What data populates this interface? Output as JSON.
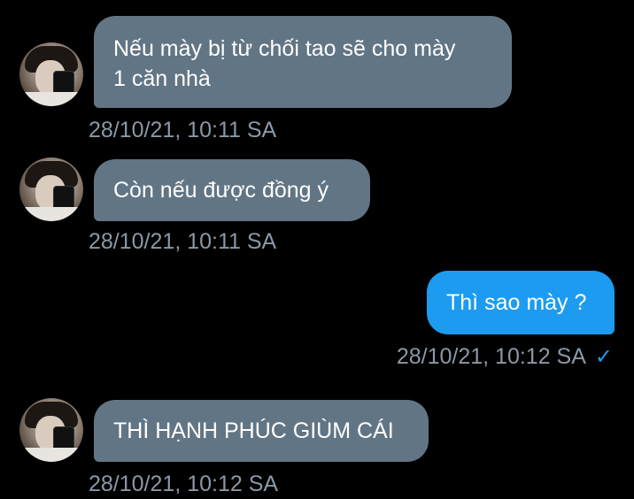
{
  "messages": [
    {
      "direction": "incoming",
      "text": "Nếu mày bị từ chối tao sẽ cho mày\n1 căn nhà",
      "timestamp": "28/10/21, 10:11 SA"
    },
    {
      "direction": "incoming",
      "text": "Còn nếu được đồng ý",
      "timestamp": "28/10/21, 10:11 SA"
    },
    {
      "direction": "outgoing",
      "text": "Thì sao mày ?",
      "timestamp": "28/10/21, 10:12 SA",
      "status_icon": "check-icon"
    },
    {
      "direction": "incoming",
      "text": "THÌ HẠNH PHÚC GIÙM CÁI",
      "timestamp": "28/10/21, 10:12 SA"
    }
  ],
  "colors": {
    "background": "#000000",
    "incoming_bubble": "#627584",
    "outgoing_bubble": "#1d9bf0",
    "timestamp": "#8b98a5",
    "check": "#1d9bf0"
  },
  "icons": {
    "read_receipt": "✓"
  }
}
